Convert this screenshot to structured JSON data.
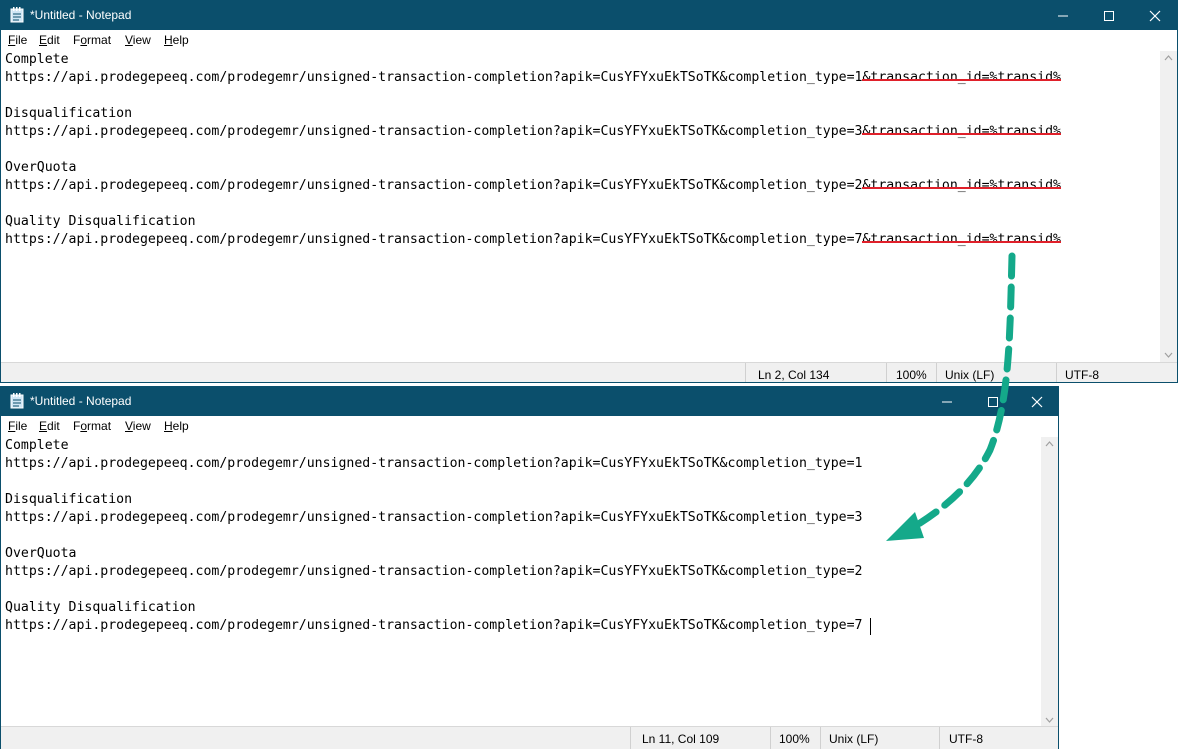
{
  "windows": [
    {
      "title": "*Untitled - Notepad",
      "menu": [
        {
          "pre": "",
          "u": "F",
          "post": "ile"
        },
        {
          "pre": "",
          "u": "E",
          "post": "dit"
        },
        {
          "pre": "F",
          "u": "o",
          "post": "rmat"
        },
        {
          "pre": "",
          "u": "V",
          "post": "iew"
        },
        {
          "pre": "",
          "u": "H",
          "post": "elp"
        }
      ],
      "lines": [
        {
          "text": "Complete",
          "strike": ""
        },
        {
          "text": "https://api.prodegepeeq.com/prodegemr/unsigned-transaction-completion?apik=CusYFYxuEkTSoTK&completion_type=1",
          "strike": "&transaction_id=%transid%"
        },
        {
          "text": "",
          "strike": ""
        },
        {
          "text": "Disqualification",
          "strike": ""
        },
        {
          "text": "https://api.prodegepeeq.com/prodegemr/unsigned-transaction-completion?apik=CusYFYxuEkTSoTK&completion_type=3",
          "strike": "&transaction_id=%transid%"
        },
        {
          "text": "",
          "strike": ""
        },
        {
          "text": "OverQuota",
          "strike": ""
        },
        {
          "text": "https://api.prodegepeeq.com/prodegemr/unsigned-transaction-completion?apik=CusYFYxuEkTSoTK&completion_type=2",
          "strike": "&transaction_id=%transid%"
        },
        {
          "text": "",
          "strike": ""
        },
        {
          "text": "Quality Disqualification",
          "strike": ""
        },
        {
          "text": "https://api.prodegepeeq.com/prodegemr/unsigned-transaction-completion?apik=CusYFYxuEkTSoTK&completion_type=7",
          "strike": "&transaction_id=%transid%"
        }
      ],
      "status": {
        "position": "Ln 2, Col 134",
        "zoom": "100%",
        "line_ending": "Unix (LF)",
        "encoding": "UTF-8"
      }
    },
    {
      "title": "*Untitled - Notepad",
      "menu": [
        {
          "pre": "",
          "u": "F",
          "post": "ile"
        },
        {
          "pre": "",
          "u": "E",
          "post": "dit"
        },
        {
          "pre": "F",
          "u": "o",
          "post": "rmat"
        },
        {
          "pre": "",
          "u": "V",
          "post": "iew"
        },
        {
          "pre": "",
          "u": "H",
          "post": "elp"
        }
      ],
      "lines": [
        {
          "text": "Complete",
          "strike": ""
        },
        {
          "text": "https://api.prodegepeeq.com/prodegemr/unsigned-transaction-completion?apik=CusYFYxuEkTSoTK&completion_type=1",
          "strike": ""
        },
        {
          "text": "",
          "strike": ""
        },
        {
          "text": "Disqualification",
          "strike": ""
        },
        {
          "text": "https://api.prodegepeeq.com/prodegemr/unsigned-transaction-completion?apik=CusYFYxuEkTSoTK&completion_type=3",
          "strike": ""
        },
        {
          "text": "",
          "strike": ""
        },
        {
          "text": "OverQuota",
          "strike": ""
        },
        {
          "text": "https://api.prodegepeeq.com/prodegemr/unsigned-transaction-completion?apik=CusYFYxuEkTSoTK&completion_type=2",
          "strike": ""
        },
        {
          "text": "",
          "strike": ""
        },
        {
          "text": "Quality Disqualification",
          "strike": ""
        },
        {
          "text": "https://api.prodegepeeq.com/prodegemr/unsigned-transaction-completion?apik=CusYFYxuEkTSoTK&completion_type=7",
          "strike": ""
        }
      ],
      "status": {
        "position": "Ln 11, Col 109",
        "zoom": "100%",
        "line_ending": "Unix (LF)",
        "encoding": "UTF-8"
      }
    }
  ],
  "colors": {
    "titlebar": "#0b4f6c",
    "strike": "#e0202a",
    "arrow": "#14a98a"
  },
  "icons": {
    "app": "notepad-icon",
    "minimize": "minimize-icon",
    "maximize": "maximize-icon",
    "close": "close-icon",
    "annotation": "dashed-arrow-icon"
  }
}
